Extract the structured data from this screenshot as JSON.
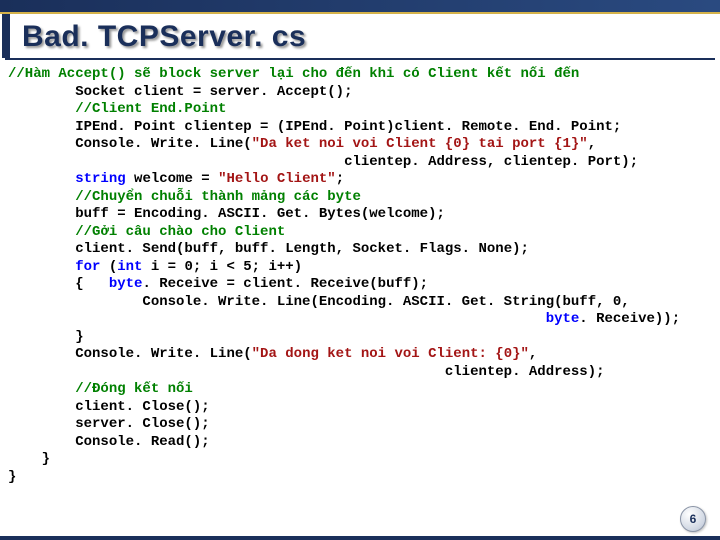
{
  "title": "Bad. TCPServer. cs",
  "page_number": "6",
  "lines": [
    {
      "indent": 0,
      "segs": [
        {
          "t": "//Hàm Accept() sẽ block server lại cho đến khi có Client kết nối đến",
          "c": "cmt"
        }
      ]
    },
    {
      "indent": 2,
      "segs": [
        {
          "t": "Socket client = server. Accept();",
          "c": ""
        }
      ]
    },
    {
      "indent": 2,
      "segs": [
        {
          "t": "//Client End.Point",
          "c": "cmt"
        }
      ]
    },
    {
      "indent": 2,
      "segs": [
        {
          "t": "IPEnd. Point clientep = (IPEnd. Point)client. Remote. End. Point;",
          "c": ""
        }
      ]
    },
    {
      "indent": 2,
      "segs": [
        {
          "t": "Console. Write. Line(",
          "c": ""
        },
        {
          "t": "\"Da ket noi voi Client {0} tai port {1}\"",
          "c": "str"
        },
        {
          "t": ",",
          "c": ""
        }
      ]
    },
    {
      "indent": 10,
      "segs": [
        {
          "t": "clientep. Address, clientep. Port);",
          "c": ""
        }
      ]
    },
    {
      "indent": 2,
      "segs": [
        {
          "t": "string",
          "c": "kw"
        },
        {
          "t": " welcome = ",
          "c": ""
        },
        {
          "t": "\"Hello Client\"",
          "c": "str"
        },
        {
          "t": ";",
          "c": ""
        }
      ]
    },
    {
      "indent": 2,
      "segs": [
        {
          "t": "//Chuyển chuỗi thành mảng các byte",
          "c": "cmt"
        }
      ]
    },
    {
      "indent": 2,
      "segs": [
        {
          "t": "buff = Encoding. ASCII. Get. Bytes(welcome);",
          "c": ""
        }
      ]
    },
    {
      "indent": 2,
      "segs": [
        {
          "t": "//Gởi câu chào cho Client",
          "c": "cmt"
        }
      ]
    },
    {
      "indent": 2,
      "segs": [
        {
          "t": "client. Send(buff, buff. Length, Socket. Flags. None);",
          "c": ""
        }
      ]
    },
    {
      "indent": 2,
      "segs": [
        {
          "t": "for",
          "c": "kw"
        },
        {
          "t": " (",
          "c": ""
        },
        {
          "t": "int",
          "c": "kw"
        },
        {
          "t": " i = 0; i < 5; i++)",
          "c": ""
        }
      ]
    },
    {
      "indent": 2,
      "segs": [
        {
          "t": "{   ",
          "c": ""
        },
        {
          "t": "byte",
          "c": "kw"
        },
        {
          "t": ". Receive = client. Receive(buff);",
          "c": ""
        }
      ]
    },
    {
      "indent": 4,
      "segs": [
        {
          "t": "Console. Write. Line(Encoding. ASCII. Get. String(buff, 0,",
          "c": ""
        }
      ]
    },
    {
      "indent": 16,
      "segs": [
        {
          "t": "byte",
          "c": "kw"
        },
        {
          "t": ". Receive));",
          "c": ""
        }
      ]
    },
    {
      "indent": 2,
      "segs": [
        {
          "t": "}",
          "c": ""
        }
      ]
    },
    {
      "indent": 2,
      "segs": [
        {
          "t": "Console. Write. Line(",
          "c": ""
        },
        {
          "t": "\"Da dong ket noi voi Client: {0}\"",
          "c": "str"
        },
        {
          "t": ",",
          "c": ""
        }
      ]
    },
    {
      "indent": 13,
      "segs": [
        {
          "t": "clientep. Address);",
          "c": ""
        }
      ]
    },
    {
      "indent": 2,
      "segs": [
        {
          "t": "//Đóng kết nối",
          "c": "cmt"
        }
      ]
    },
    {
      "indent": 2,
      "segs": [
        {
          "t": "client. Close();",
          "c": ""
        }
      ]
    },
    {
      "indent": 2,
      "segs": [
        {
          "t": "server. Close();",
          "c": ""
        }
      ]
    },
    {
      "indent": 2,
      "segs": [
        {
          "t": "Console. Read();",
          "c": ""
        }
      ]
    },
    {
      "indent": 1,
      "segs": [
        {
          "t": "}",
          "c": ""
        }
      ]
    },
    {
      "indent": 0,
      "segs": [
        {
          "t": "}",
          "c": ""
        }
      ]
    }
  ]
}
